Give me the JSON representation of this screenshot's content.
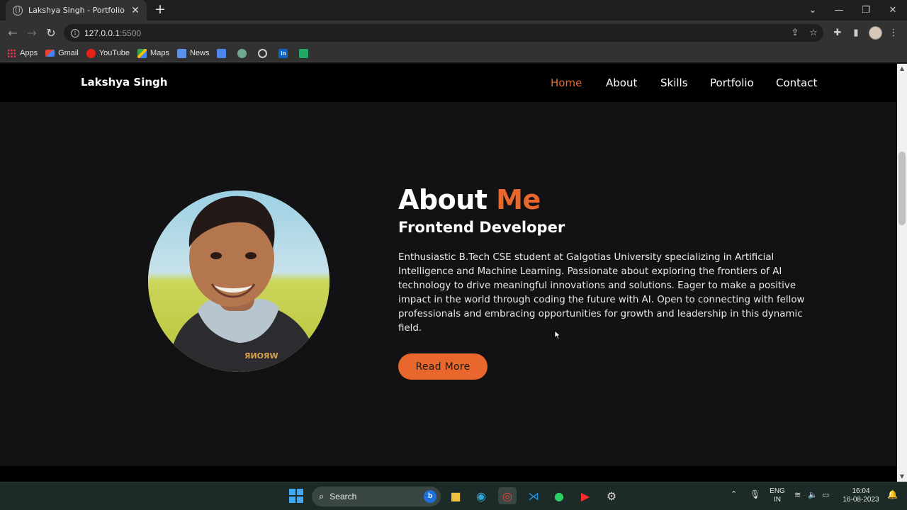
{
  "browser": {
    "tab_title": "Lakshya Singh - Portfolio",
    "url_host": "127.0.0.1",
    "url_port": ":5500",
    "bookmarks": [
      "Apps",
      "Gmail",
      "YouTube",
      "Maps",
      "News"
    ]
  },
  "site": {
    "logo": "Lakshya Singh",
    "nav": [
      "Home",
      "About",
      "Skills",
      "Portfolio",
      "Contact"
    ],
    "active_nav": "Home",
    "accent_color": "#e8672c"
  },
  "about": {
    "heading_main": "About",
    "heading_accent": "Me",
    "subheading": "Frontend Developer",
    "bio": "Enthusiastic B.Tech CSE student at Galgotias University specializing in Artificial Intelligence and Machine Learning. Passionate about exploring the frontiers of AI technology to drive meaningful innovations and solutions. Eager to make a positive impact in the world through coding the future with AI. Open to connecting with fellow professionals and embracing opportunities for growth and leadership in this dynamic field.",
    "button": "Read More"
  },
  "taskbar": {
    "search_label": "Search",
    "lang_top": "ENG",
    "lang_bottom": "IN",
    "time": "16:04",
    "date": "16-08-2023"
  }
}
